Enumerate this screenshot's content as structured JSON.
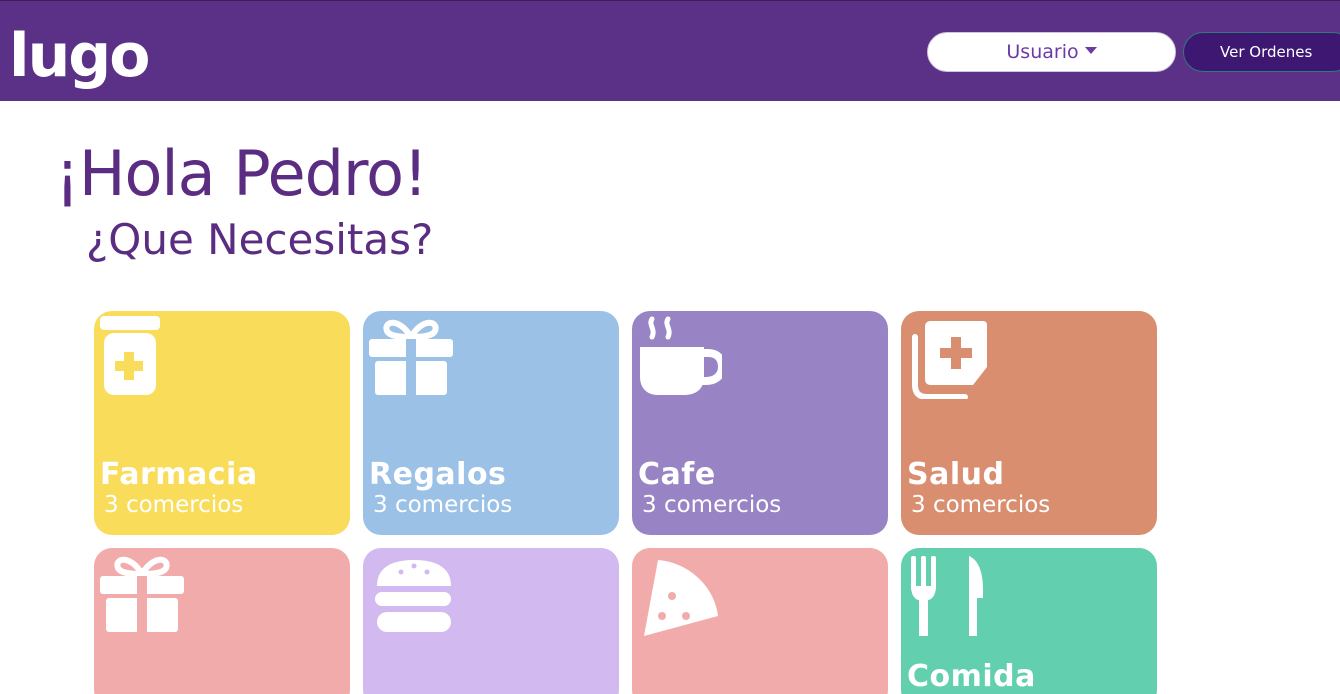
{
  "header": {
    "logo": "lugo",
    "user_menu_label": "Usuario",
    "orders_button_label": "Ver Ordenes",
    "colors": {
      "bar": "#5b3187",
      "orders_button": "#3e1773"
    }
  },
  "main": {
    "greeting": "¡Hola Pedro!",
    "question": "¿Que Necesitas?"
  },
  "categories": [
    {
      "name": "Farmacia",
      "count": "3 comercios",
      "icon": "pill-bottle-icon",
      "color": "#f8dc5a"
    },
    {
      "name": "Regalos",
      "count": "3 comercios",
      "icon": "gift-icon",
      "color": "#9cc1e6"
    },
    {
      "name": "Cafe",
      "count": "3 comercios",
      "icon": "coffee-cup-icon",
      "color": "#9883c4"
    },
    {
      "name": "Salud",
      "count": "3 comercios",
      "icon": "medical-notes-icon",
      "color": "#d98e70"
    },
    {
      "name": "",
      "count": "",
      "icon": "gift-icon",
      "color": "#f2abab"
    },
    {
      "name": "",
      "count": "",
      "icon": "hamburger-icon",
      "color": "#d2b9ef"
    },
    {
      "name": "",
      "count": "",
      "icon": "pizza-icon",
      "color": "#f2abab"
    },
    {
      "name": "Comida",
      "count": "",
      "icon": "fork-knife-icon",
      "color": "#62cfaf"
    }
  ]
}
